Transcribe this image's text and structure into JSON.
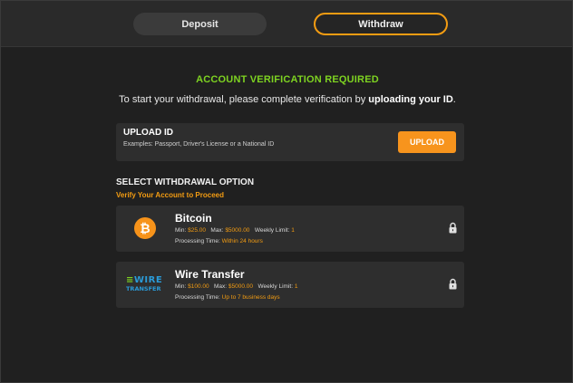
{
  "tabs": {
    "deposit": "Deposit",
    "withdraw": "Withdraw"
  },
  "verification": {
    "title": "ACCOUNT VERIFICATION REQUIRED",
    "subtitle_prefix": "To start your withdrawal, please complete verification by ",
    "subtitle_bold": "uploading your ID",
    "subtitle_suffix": "."
  },
  "upload": {
    "title": "UPLOAD ID",
    "description": "Examples: Passport, Driver's License or a National ID",
    "button": "UPLOAD"
  },
  "withdrawal_options": {
    "title": "SELECT WITHDRAWAL OPTION",
    "subtitle": "Verify Your Account to Proceed",
    "items": [
      {
        "name": "Bitcoin",
        "icon": "bitcoin-icon",
        "icon_glyph": "₿",
        "min_label": "Min:",
        "min": "$25.00",
        "max_label": "Max:",
        "max": "$5000.00",
        "weekly_label": "Weekly Limit:",
        "weekly": "1",
        "processing_label": "Processing Time:",
        "processing": "Within 24 hours"
      },
      {
        "name": "Wire Transfer",
        "icon": "wire-transfer-logo",
        "logo_line1": "WIRE",
        "logo_line2": "TRANSFER",
        "min_label": "Min:",
        "min": "$100.00",
        "max_label": "Max:",
        "max": "$5000.00",
        "weekly_label": "Weekly Limit:",
        "weekly": "1",
        "processing_label": "Processing Time:",
        "processing": "Up to 7 business days"
      }
    ]
  },
  "colors": {
    "accent": "#f39c12",
    "success": "#7ed321",
    "background": "#202020",
    "card": "#2e2e2e"
  }
}
